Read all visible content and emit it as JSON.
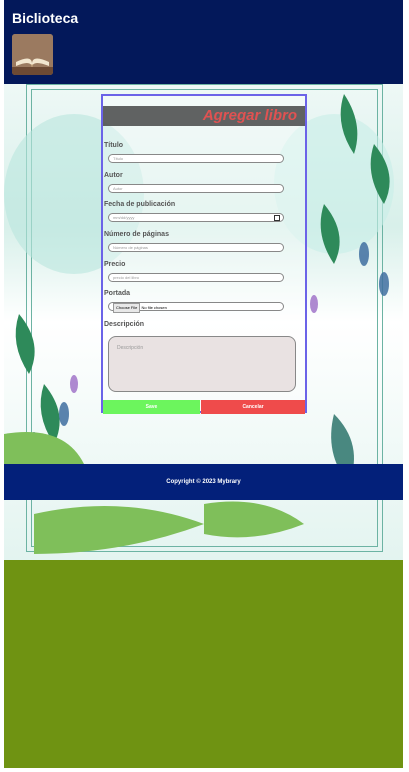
{
  "header": {
    "title": "Biclioteca"
  },
  "form": {
    "title": "Agregar libro",
    "fields": [
      {
        "label": "Título",
        "placeholder": "Título"
      },
      {
        "label": "Autor",
        "placeholder": "Autor"
      },
      {
        "label": "Fecha de publicación",
        "placeholder": "mm/dd/yyyy"
      },
      {
        "label": "Número de páginas",
        "placeholder": "Número de páginas"
      },
      {
        "label": "Precio",
        "placeholder": "precio del libro"
      }
    ],
    "portada_label": "Portada",
    "file_button": "Choose File",
    "file_status": "No file chosen",
    "descripcion_label": "Descripción",
    "descripcion_placeholder": "Descripción",
    "buttons": {
      "save": "Save",
      "cancel": "Cancelar"
    },
    "colors": {
      "save": "#6cf55d",
      "cancel": "#ef4b4b"
    }
  },
  "footer": {
    "text": "Copyright © 2023 Mybrary"
  }
}
